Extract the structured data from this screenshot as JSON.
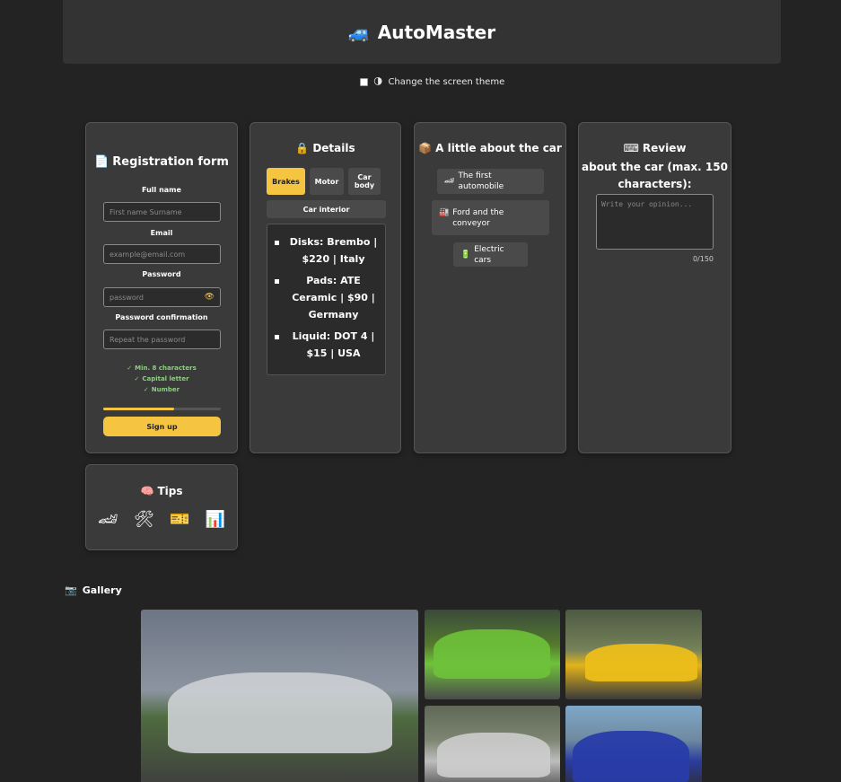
{
  "header": {
    "icon": "🚙",
    "title": "AutoMaster"
  },
  "theme_toggle": {
    "icon": "🌗",
    "label": "Change the screen theme",
    "checked": false
  },
  "registration": {
    "icon": "📄",
    "title": "Registration form",
    "full_name": {
      "label": "Full name",
      "placeholder": "First name Surname"
    },
    "email": {
      "label": "Email",
      "placeholder": "example@email.com"
    },
    "password": {
      "label": "Password",
      "placeholder": "password",
      "toggle_icon": "👁"
    },
    "password_confirm": {
      "label": "Password confirmation",
      "placeholder": "Repeat the password"
    },
    "checks": [
      "Min. 8 characters",
      "Capital letter",
      "Number"
    ],
    "strength": 0.6,
    "submit_label": "Sign up",
    "accent": "#f5c542"
  },
  "details": {
    "icon": "🔒",
    "title": "Details",
    "tabs": [
      "Brakes",
      "Motor",
      "Car body"
    ],
    "tab_wide": "Car interior",
    "active_tab": "Brakes",
    "specs": [
      "Disks: Brembo | $220 | Italy",
      "Pads: ATE Ceramic | $90 | Germany",
      "Liquid: DOT 4 | $15 | USA"
    ]
  },
  "about": {
    "icon": "📦",
    "title": "A little about the car",
    "items": [
      {
        "icon": "🏎",
        "label": "The first automobile"
      },
      {
        "icon": "🏭",
        "label": "Ford and the conveyor"
      },
      {
        "icon": "🔋",
        "label": "Electric cars"
      }
    ]
  },
  "review": {
    "icon": "⌨",
    "title": "Review",
    "subtitle": "about the car (max. 150 characters):",
    "placeholder": "Write your opinion...",
    "counter": "0/150"
  },
  "tips": {
    "icon": "🧠",
    "title": "Tips",
    "icons": [
      "🏎",
      "🛠",
      "🎫",
      "📊"
    ]
  },
  "gallery": {
    "icon": "📷",
    "title": "Gallery"
  }
}
